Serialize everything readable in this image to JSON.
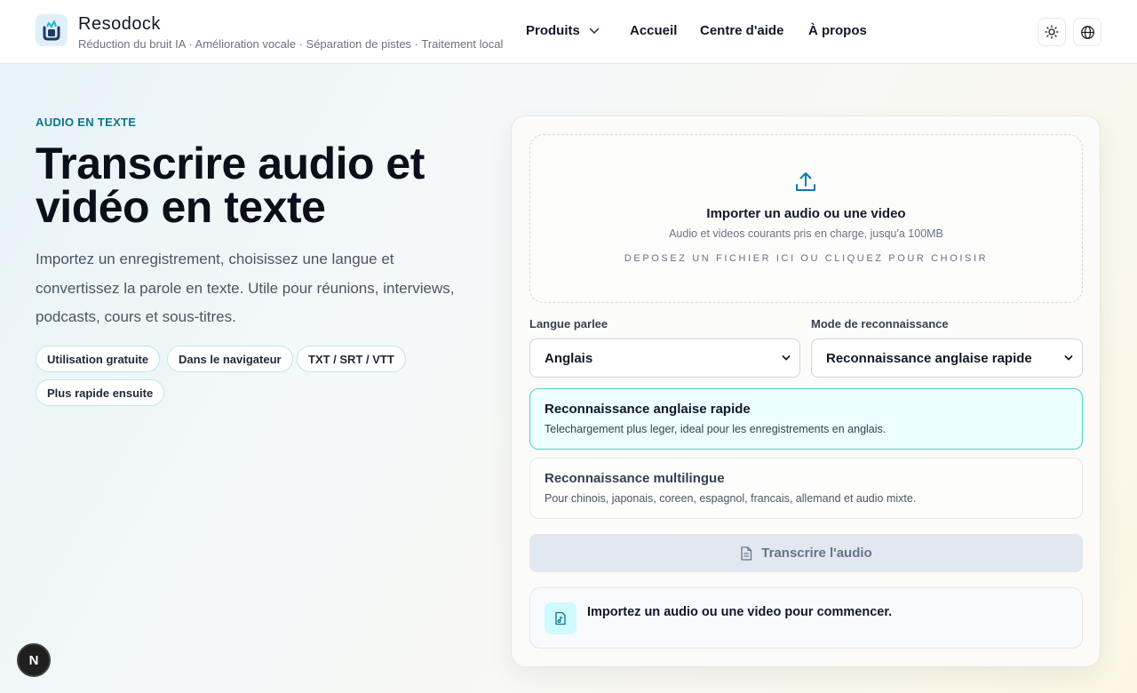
{
  "header": {
    "brand_name": "Resodock",
    "brand_tagline": "Réduction du bruit IA · Amélioration vocale · Séparation de pistes · Traitement local",
    "nav": {
      "products": "Produits",
      "home": "Accueil",
      "help": "Centre d'aide",
      "about": "À propos"
    },
    "icons": [
      "sun-icon",
      "globe-icon"
    ]
  },
  "hero": {
    "eyebrow": "AUDIO EN TEXTE",
    "title": "Transcrire audio et vidéo en texte",
    "description": "Importez un enregistrement, choisissez une langue et convertissez la parole en texte. Utile pour réunions, interviews, podcasts, cours et sous-titres.",
    "chips": [
      "Utilisation gratuite",
      "Dans le navigateur",
      "TXT / SRT / VTT",
      "Plus rapide ensuite"
    ]
  },
  "upload": {
    "title": "Importer un audio ou une video",
    "subtitle": "Audio et videos courants pris en charge, jusqu'a 100MB",
    "hint": "DEPOSEZ UN FICHIER ICI OU CLIQUEZ POUR CHOISIR"
  },
  "form": {
    "language_label": "Langue parlee",
    "language_value": "Anglais",
    "mode_label": "Mode de reconnaissance",
    "mode_value": "Reconnaissance anglaise rapide"
  },
  "options": [
    {
      "title": "Reconnaissance anglaise rapide",
      "description": "Telechargement plus leger, ideal pour les enregistrements en anglais.",
      "selected": true
    },
    {
      "title": "Reconnaissance multilingue",
      "description": "Pour chinois, japonais, coreen, espagnol, francais, allemand et audio mixte.",
      "selected": false
    }
  ],
  "actions": {
    "transcribe_label": "Transcrire l'audio"
  },
  "status": {
    "message": "Importez un audio ou une video pour commencer."
  },
  "fab": {
    "label": "N"
  },
  "colors": {
    "accent": "#0e7490",
    "selected_border": "#4fd1c5",
    "selected_bg": "#ecfeff",
    "disabled_button": "#e2e8f0"
  }
}
